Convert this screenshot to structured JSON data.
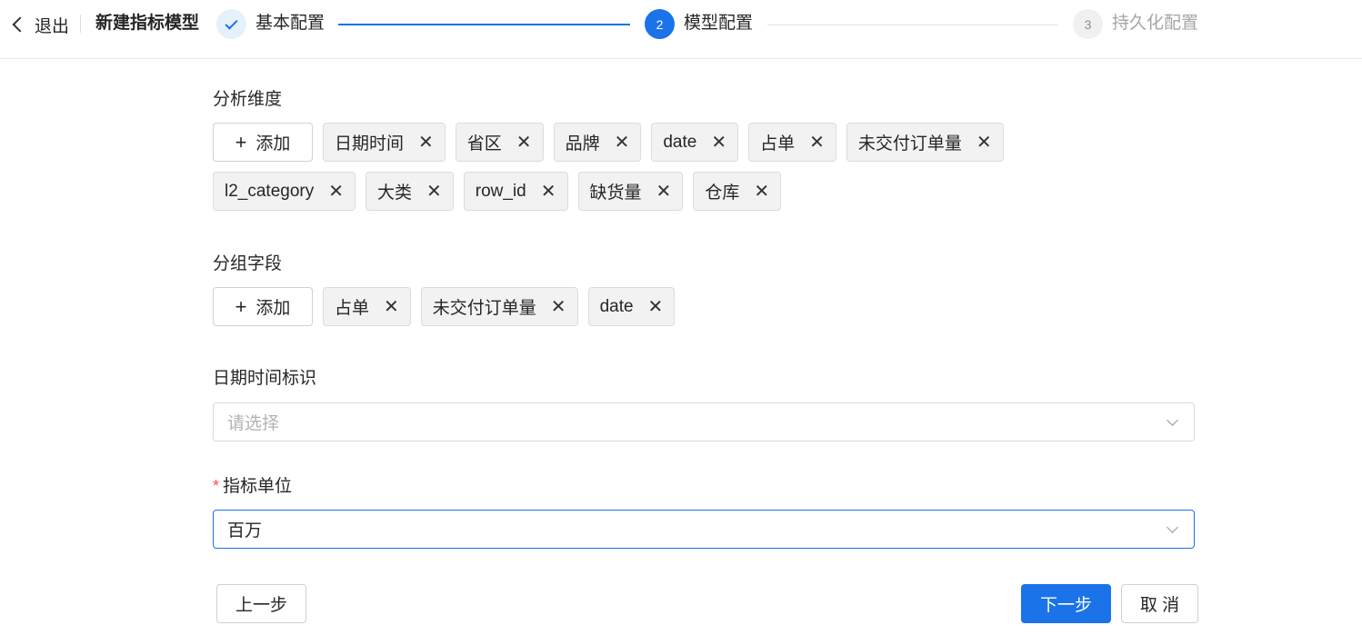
{
  "header": {
    "exit_label": "退出",
    "title": "新建指标模型",
    "steps": [
      {
        "number": "",
        "label": "基本配置",
        "state": "done"
      },
      {
        "number": "2",
        "label": "模型配置",
        "state": "active"
      },
      {
        "number": "3",
        "label": "持久化配置",
        "state": "wait"
      }
    ]
  },
  "dimensions": {
    "label": "分析维度",
    "add_label": "添加",
    "tags_row1": [
      "日期时间",
      "省区",
      "品牌",
      "date",
      "占单",
      "未交付订单量"
    ],
    "tags_row2": [
      "l2_category",
      "大类",
      "row_id",
      "缺货量",
      "仓库"
    ]
  },
  "group_fields": {
    "label": "分组字段",
    "add_label": "添加",
    "tags": [
      "占单",
      "未交付订单量",
      "date"
    ]
  },
  "datetime_flag": {
    "label": "日期时间标识",
    "placeholder": "请选择"
  },
  "unit": {
    "required_mark": "*",
    "label": "指标单位",
    "value": "百万"
  },
  "footer": {
    "prev_label": "上一步",
    "next_label": "下一步",
    "cancel_label": "取 消"
  },
  "colors": {
    "primary": "#1a73e8",
    "required": "#ff4d4f"
  }
}
